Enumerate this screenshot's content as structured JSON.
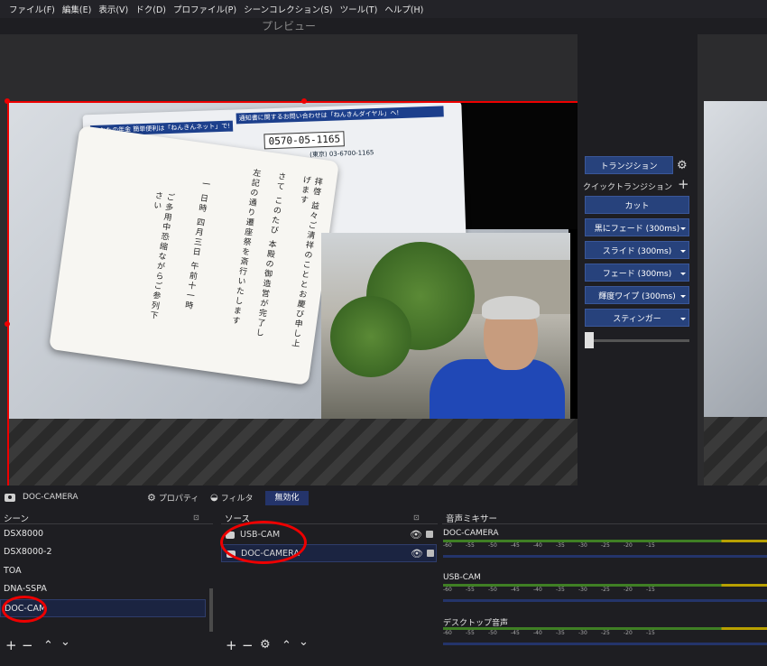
{
  "menu": [
    "ファイル(F)",
    "編集(E)",
    "表示(V)",
    "ドク(D)",
    "プロファイル(P)",
    "シーンコレクション(S)",
    "ツール(T)",
    "ヘルプ(H)"
  ],
  "preview": {
    "label": "プレビュー"
  },
  "canvas_text": {
    "banner1": "あなたの年金 簡単便利は「ねんきんネット」で!",
    "banner2": "通知書に関するお問い合わせは「ねんきんダイヤル」へ!",
    "phone": "0570-05-1165",
    "phone2": "(東京) 03-6700-1165"
  },
  "transition": {
    "button": "トランジション",
    "quick_label": "クイックトランジション",
    "items": [
      "カット",
      "黒にフェード (300ms)",
      "スライド (300ms)",
      "フェード (300ms)",
      "輝度ワイプ (300ms)",
      "スティンガー"
    ]
  },
  "toolbar": {
    "selected_source": "DOC-CAMERA",
    "properties": "プロパティ",
    "filters": "フィルタ",
    "disable": "無効化"
  },
  "scenes": {
    "title": "シーン",
    "items": [
      "DSX8000",
      "DSX8000-2",
      "TOA",
      "DNA-SSPA",
      "DOC-CAM"
    ],
    "active_index": 4
  },
  "sources": {
    "title": "ソース",
    "items": [
      "USB-CAM",
      "DOC-CAMERA"
    ],
    "active_index": 1
  },
  "mixer": {
    "title": "音声ミキサー",
    "channels": [
      "DOC-CAMERA",
      "USB-CAM",
      "デスクトップ音声"
    ],
    "ticks": [
      "-60",
      "-55",
      "-50",
      "-45",
      "-40",
      "-35",
      "-30",
      "-25",
      "-20",
      "-15"
    ]
  },
  "colors": {
    "accent": "#27427c",
    "selection_border": "#e00000",
    "meter_green": "#3f7f24",
    "meter_yellow": "#b8a000"
  }
}
